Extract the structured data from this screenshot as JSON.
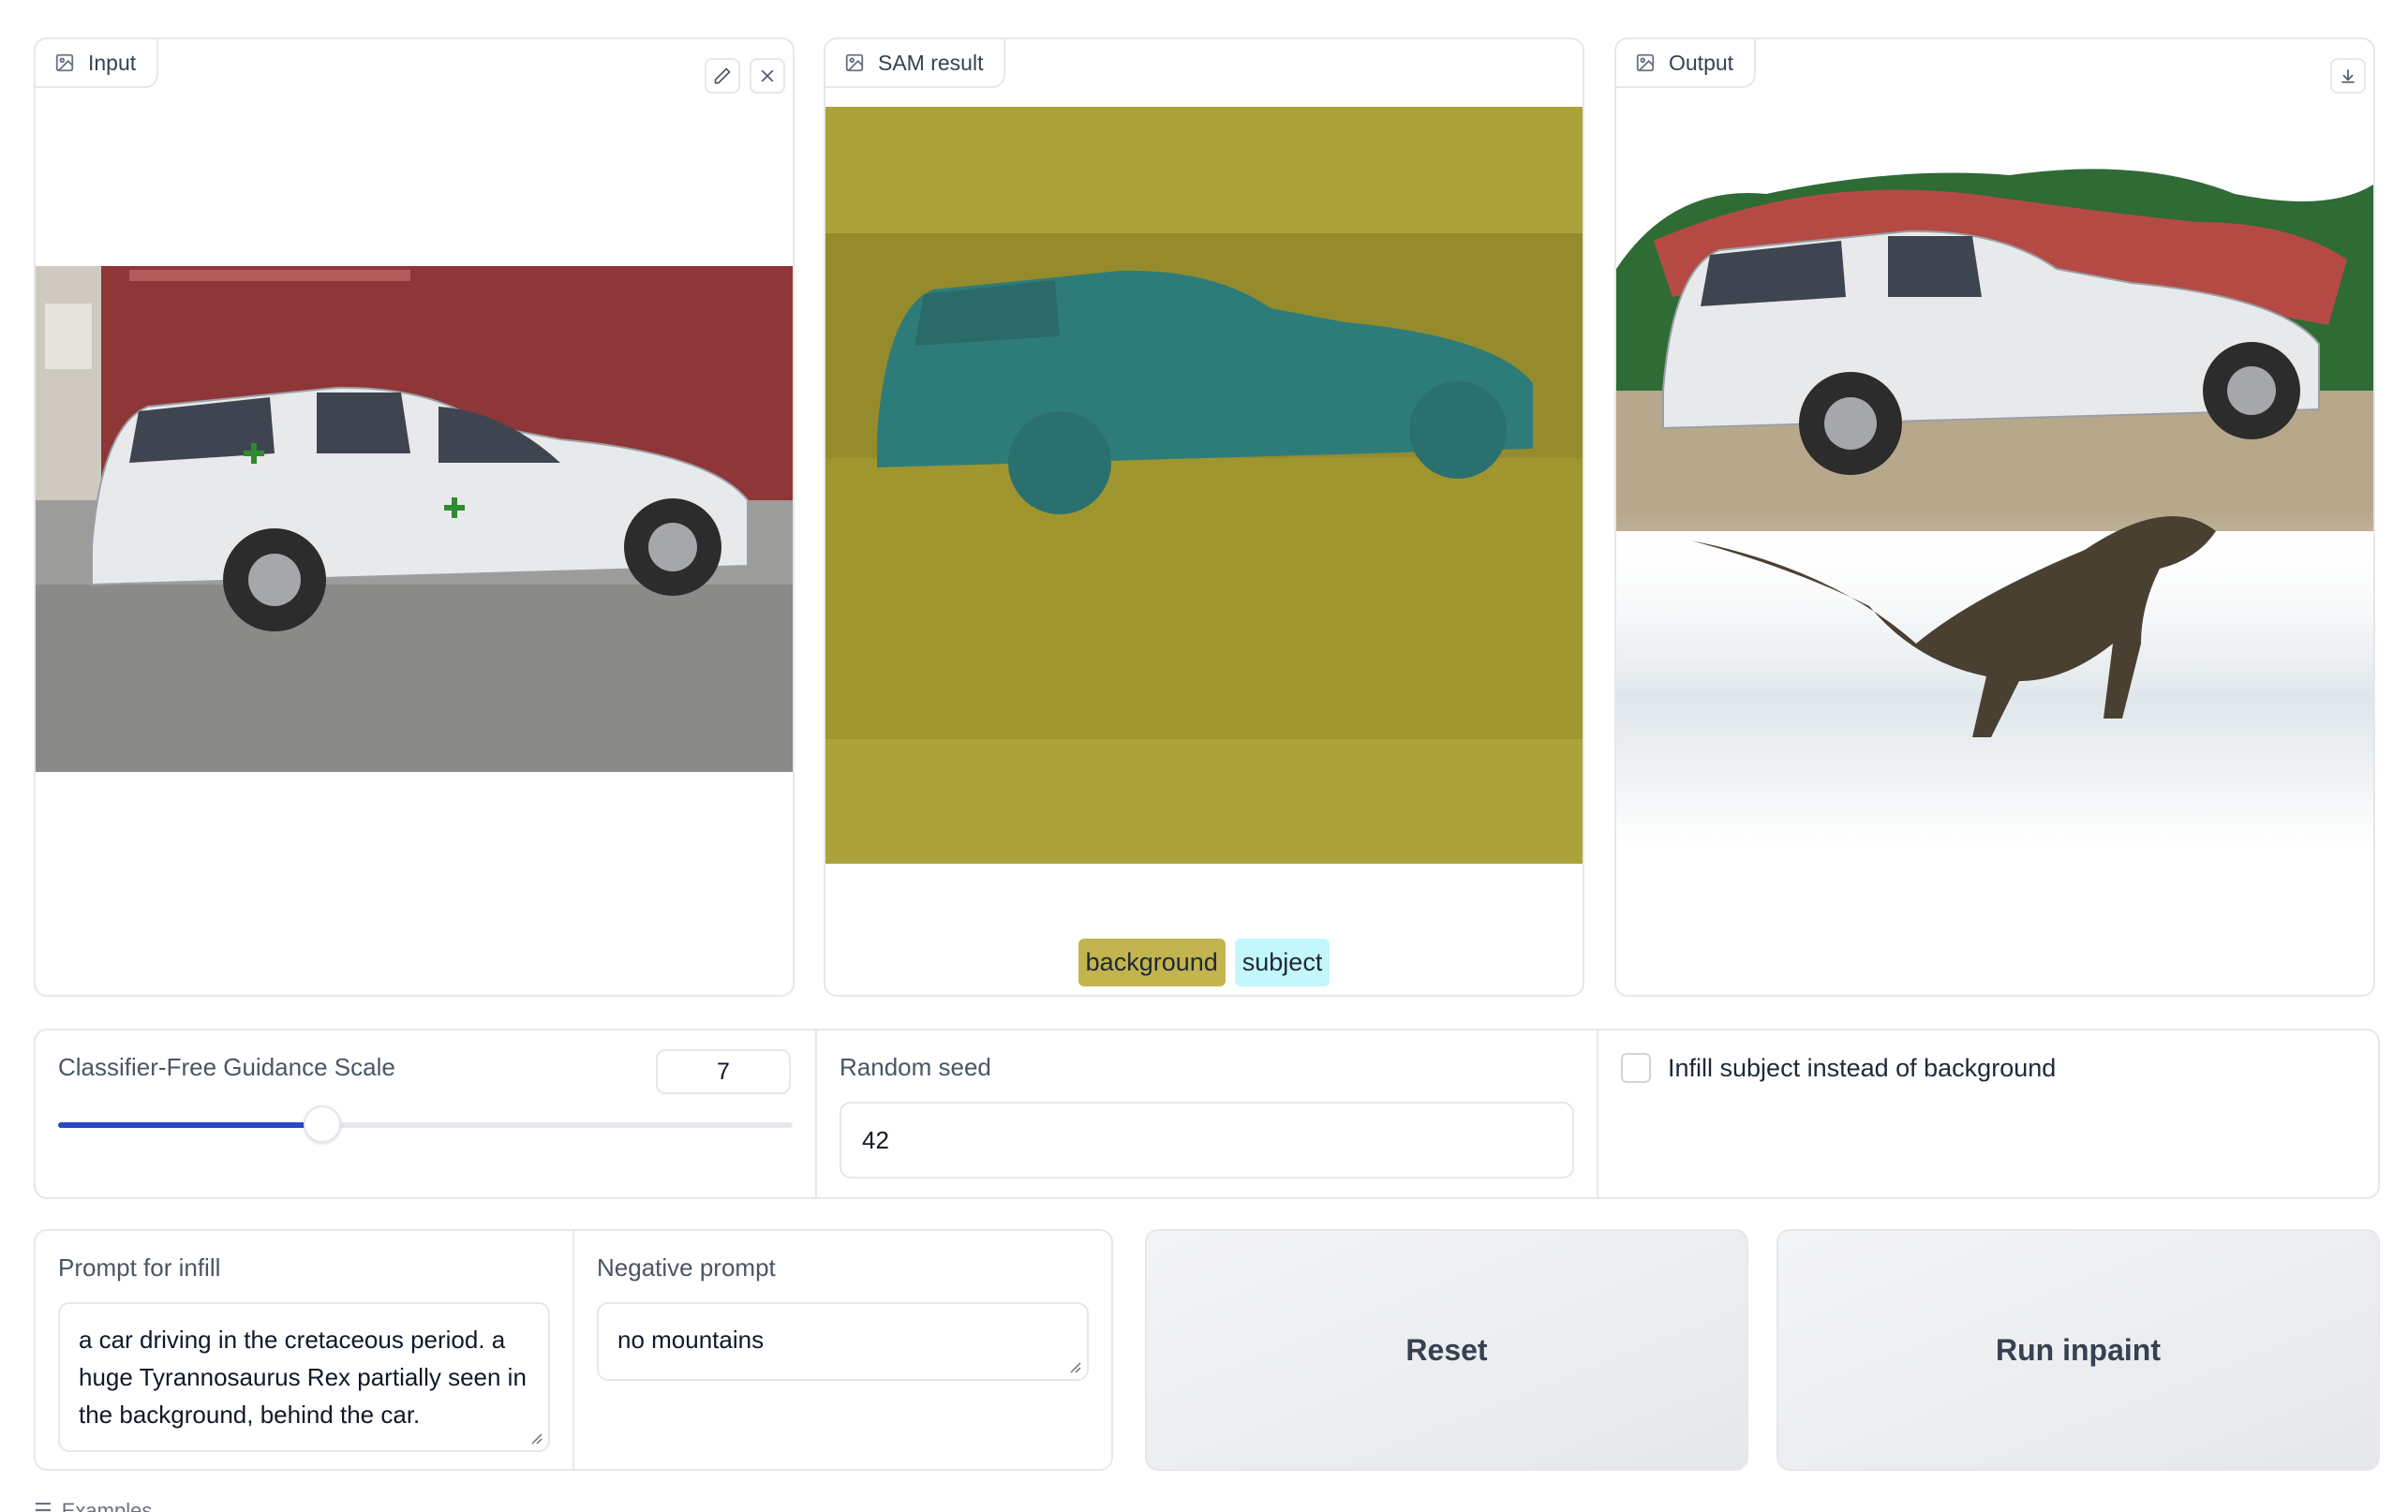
{
  "panels": {
    "input_label": "Input",
    "sam_label": "SAM result",
    "output_label": "Output"
  },
  "legend": {
    "background": "background",
    "subject": "subject",
    "background_color": "#c2b44e",
    "subject_color": "#c4f7fb"
  },
  "settings": {
    "cfg_label": "Classifier-Free Guidance Scale",
    "cfg_value": "7",
    "cfg_fraction": 0.36,
    "seed_label": "Random seed",
    "seed_value": "42",
    "infill_subject_label": "Infill subject instead of background",
    "infill_subject_checked": false
  },
  "prompts": {
    "prompt_label": "Prompt for infill",
    "prompt_value": "a car driving in the cretaceous period. a huge Tyrannosaurus Rex partially seen in the background, behind the car.",
    "negative_label": "Negative prompt",
    "negative_value": "no mountains"
  },
  "buttons": {
    "reset": "Reset",
    "run": "Run inpaint"
  },
  "examples_label": "Examples",
  "colors": {
    "accent": "#2b47c9",
    "sam_background": "#aba23a",
    "sam_subject": "#2e7c7a",
    "marker": "#2f8a2f"
  }
}
